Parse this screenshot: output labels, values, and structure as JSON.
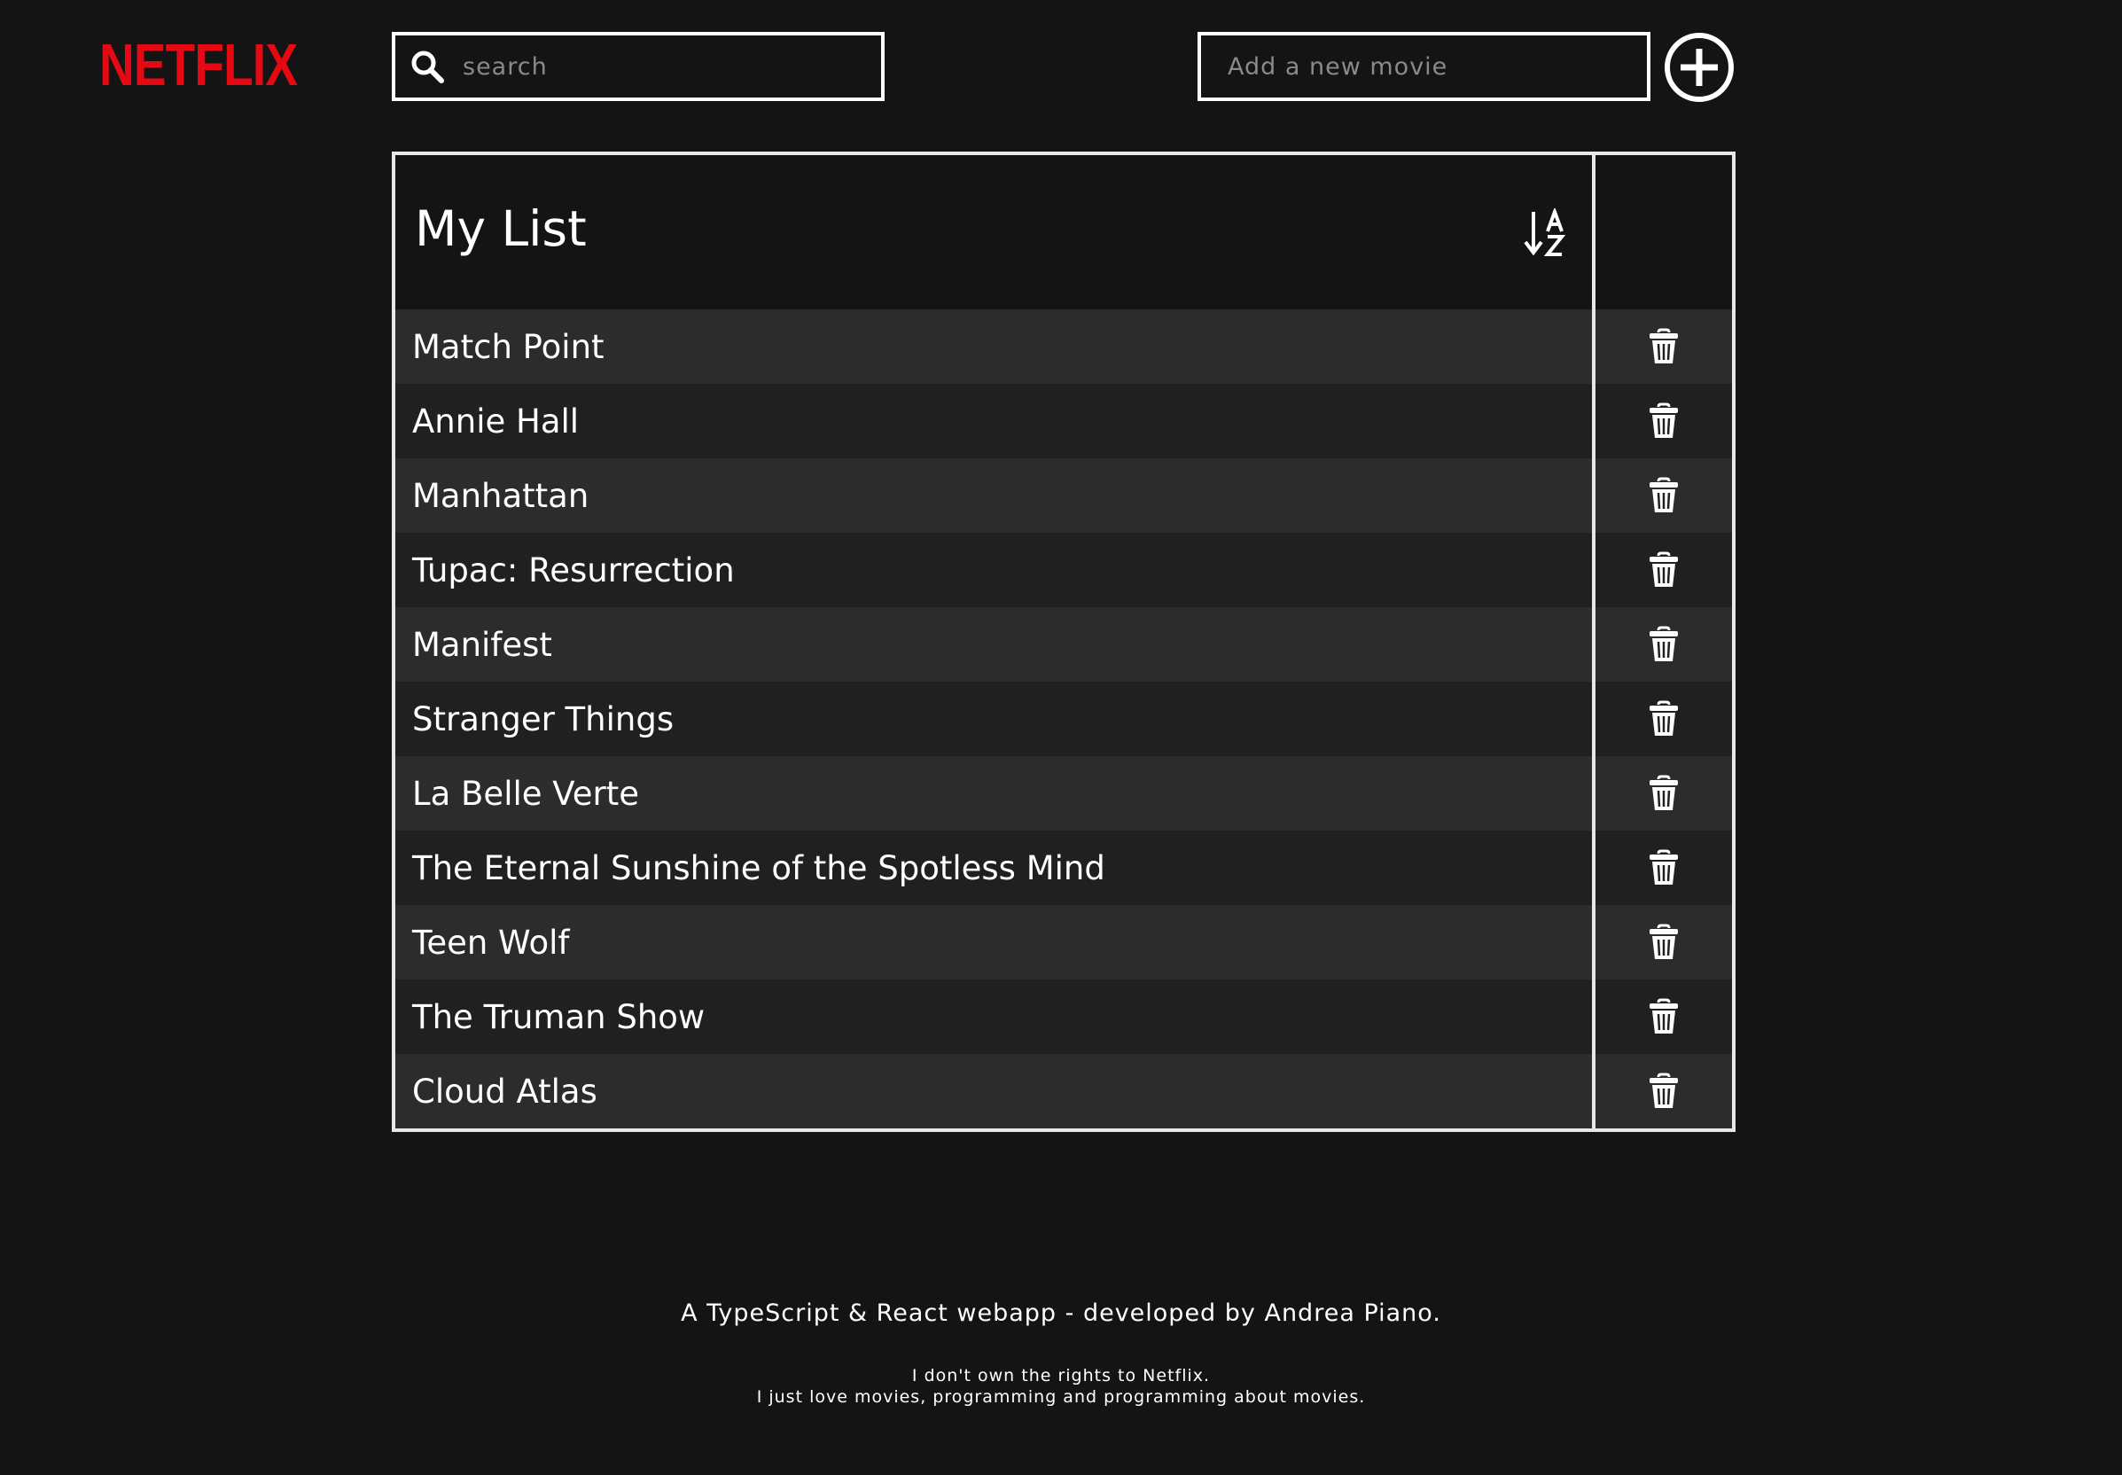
{
  "app": {
    "logo_text": "NETFLIX",
    "brand_color": "#e50914",
    "background_color": "#141414"
  },
  "search": {
    "icon": "search-icon",
    "value": "",
    "placeholder": "search"
  },
  "add_movie": {
    "value": "",
    "placeholder": "Add a new movie",
    "button_icon": "plus-circle-icon"
  },
  "list": {
    "title": "My List",
    "sort_icon": "sort-alpha-down-icon",
    "delete_icon": "trash-icon",
    "row_colors": [
      "#2c2c2c",
      "#202020"
    ],
    "movies": [
      "Match Point",
      "Annie Hall",
      "Manhattan",
      "Tupac: Resurrection",
      "Manifest",
      "Stranger Things",
      "La Belle Verte",
      "The Eternal Sunshine of the Spotless Mind",
      "Teen Wolf",
      "The Truman Show",
      "Cloud Atlas"
    ]
  },
  "footer": {
    "credit": "A TypeScript & React webapp - developed by Andrea Piano.",
    "disclaimer_line1": "I don't own the rights to Netflix.",
    "disclaimer_line2": "I just love movies, programming and programming about movies."
  }
}
